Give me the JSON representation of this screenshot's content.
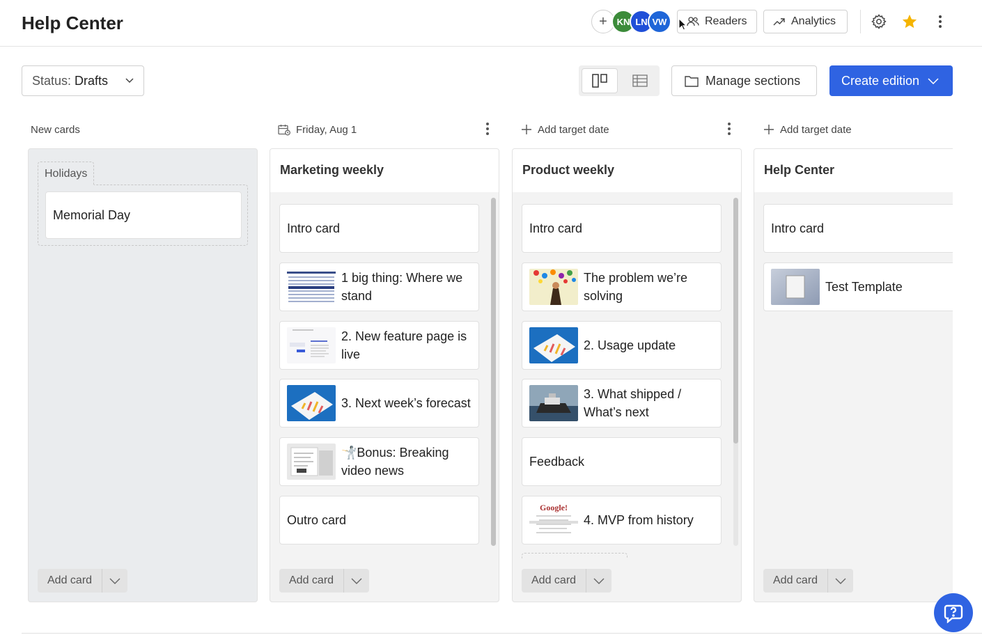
{
  "header": {
    "title": "Help Center",
    "avatars": [
      {
        "initials": "KN",
        "color": "#3c8b3a"
      },
      {
        "initials": "LN",
        "color": "#1f4fd8"
      },
      {
        "initials": "VW",
        "color": "#1f66d8"
      }
    ],
    "add_member_label": "+",
    "readers_label": "Readers",
    "analytics_label": "Analytics",
    "icons": [
      "settings-icon",
      "star-icon",
      "more-vertical-icon"
    ]
  },
  "toolbar": {
    "status_label": "Status:",
    "status_value": "Drafts",
    "manage_sections_label": "Manage sections",
    "create_edition_label": "Create edition",
    "accent_color": "#2f63e2",
    "star_color": "#f5b400"
  },
  "columns": [
    {
      "header": "New cards",
      "group_label": "Holidays",
      "cards": [
        "Memorial Day"
      ],
      "add_card_label": "Add card"
    },
    {
      "header": "Friday, Aug 1",
      "name": "Marketing weekly",
      "cards": [
        {
          "title": "Intro card"
        },
        {
          "title": "1 big thing: Where we stand",
          "thumb": "document-thumbnail"
        },
        {
          "title": "2. New feature page is live",
          "thumb": "webpage-thumbnail"
        },
        {
          "title": "3. Next week’s forecast",
          "thumb": "chart-thumbnail"
        },
        {
          "title": "🤺Bonus: Breaking video news",
          "thumb": "screenshot-thumbnail"
        },
        {
          "title": "Outro card"
        }
      ],
      "add_card_label": "Add card"
    },
    {
      "header": "Add target date",
      "name": "Product weekly",
      "cards": [
        {
          "title": "Intro card"
        },
        {
          "title": "The problem we’re solving",
          "thumb": "illustration-thumbnail"
        },
        {
          "title": "2. Usage update",
          "thumb": "chart-thumbnail"
        },
        {
          "title": "3. What shipped / What’s next",
          "thumb": "ship-thumbnail"
        },
        {
          "title": "Feedback"
        },
        {
          "title": "4. MVP from history",
          "thumb": "google-thumbnail"
        }
      ],
      "add_card_label": "Add card"
    },
    {
      "header": "Add target date",
      "name": "Help Center",
      "cards": [
        {
          "title": "Intro card"
        },
        {
          "title": "Test Template",
          "thumb": "template-thumbnail"
        }
      ],
      "add_card_label": "Add card"
    }
  ],
  "google_logo_text": "Google!"
}
